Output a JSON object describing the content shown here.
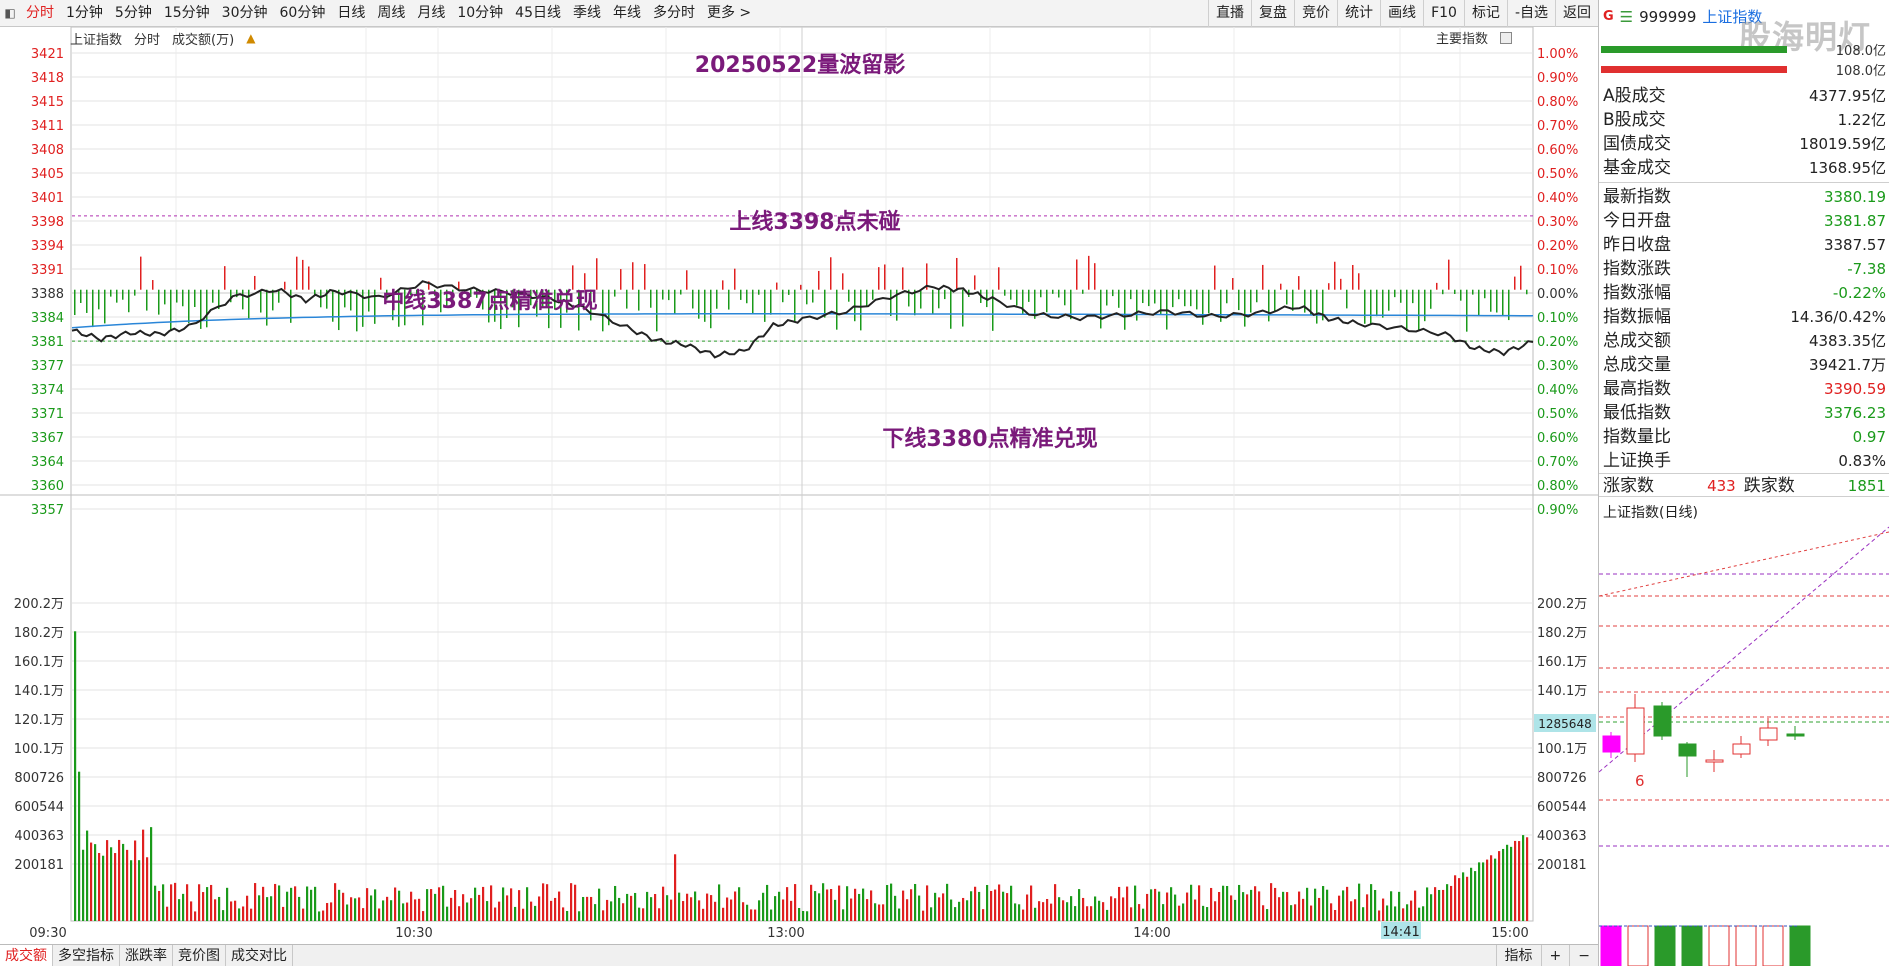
{
  "toolbar": {
    "periods": [
      {
        "label": "分时",
        "active": true
      },
      {
        "label": "1分钟"
      },
      {
        "label": "5分钟"
      },
      {
        "label": "15分钟"
      },
      {
        "label": "30分钟"
      },
      {
        "label": "60分钟"
      },
      {
        "label": "日线"
      },
      {
        "label": "周线"
      },
      {
        "label": "月线"
      },
      {
        "label": "10分钟"
      },
      {
        "label": "45日线"
      },
      {
        "label": "季线"
      },
      {
        "label": "年线"
      },
      {
        "label": "多分时"
      },
      {
        "label": "更多 >"
      }
    ],
    "right": [
      "直播",
      "复盘",
      "竞价",
      "统计",
      "画线",
      "F10",
      "标记",
      "-自选",
      "返回"
    ]
  },
  "chart": {
    "header_items": [
      "上证指数",
      "分时",
      "成交额(万)"
    ],
    "header_right": "主要指数",
    "title_annotation": "20250522量波留影",
    "annotations": {
      "upper": "上线3398点未碰",
      "middle": "中线3387点精准兑现",
      "lower": "下线3380点精准兑现"
    },
    "price_ticks": [
      "3421",
      "3418",
      "3415",
      "3411",
      "3408",
      "3405",
      "3401",
      "3398",
      "3394",
      "3391",
      "3388",
      "3384",
      "3381",
      "3377",
      "3374",
      "3371",
      "3367",
      "3364",
      "3360",
      "3357"
    ],
    "pct_ticks": [
      "1.00%",
      "0.90%",
      "0.80%",
      "0.70%",
      "0.60%",
      "0.50%",
      "0.40%",
      "0.30%",
      "0.20%",
      "0.10%",
      "0.00%",
      "0.10%",
      "0.20%",
      "0.30%",
      "0.40%",
      "0.50%",
      "0.60%",
      "0.70%",
      "0.80%",
      "0.90%"
    ],
    "vol_ticks": [
      "200.2万",
      "180.2万",
      "160.1万",
      "140.1万",
      "120.1万",
      "100.1万",
      "800726",
      "600544",
      "400363",
      "200181"
    ],
    "time_ticks": [
      "09:30",
      "10:30",
      "13:00",
      "14:00",
      "15:00"
    ],
    "cursor_time": "14:41",
    "cursor_value": "1285648",
    "prev_close": 3387.57,
    "colors": {
      "up": "#e02020",
      "down": "#1a9a1a",
      "price_line": "#222222",
      "avg_line": "#2a86d8",
      "annot": "#7a1a7a",
      "ref_purple": "#b030b0"
    }
  },
  "chart_data": {
    "type": "line",
    "title": "20250522量波留影",
    "ylabel": "上证指数",
    "ylim": [
      3355.5,
      3421
    ],
    "reference_lines": [
      {
        "label": "上线3398点未碰",
        "value": 3398
      },
      {
        "label": "下线3380点精准兑现",
        "value": 3380
      }
    ],
    "x": [
      "09:30",
      "10:30",
      "13:00",
      "14:00",
      "15:00"
    ],
    "series": [
      {
        "name": "上证指数",
        "values": [
          3381.87,
          3386.2,
          3387.4,
          3384.5,
          3380.19
        ]
      }
    ],
    "volume_ylim": [
      0,
      2002000
    ]
  },
  "side": {
    "g": "G",
    "eq": "☰",
    "code": "999999",
    "name": "上证指数",
    "watermark": "股海明灯",
    "amt1": "108.0亿",
    "amt2": "108.0亿",
    "group1": [
      {
        "label": "A股成交",
        "value": "4377.95亿"
      },
      {
        "label": "B股成交",
        "value": "1.22亿"
      },
      {
        "label": "国债成交",
        "value": "18019.59亿"
      },
      {
        "label": "基金成交",
        "value": "1368.95亿"
      }
    ],
    "group2": [
      {
        "label": "最新指数",
        "value": "3380.19",
        "color": "green"
      },
      {
        "label": "今日开盘",
        "value": "3381.87",
        "color": "green"
      },
      {
        "label": "昨日收盘",
        "value": "3387.57",
        "color": ""
      },
      {
        "label": "指数涨跌",
        "value": "-7.38",
        "color": "green"
      },
      {
        "label": "指数涨幅",
        "value": "-0.22%",
        "color": "green"
      },
      {
        "label": "指数振幅",
        "value": "14.36/0.42%",
        "color": ""
      },
      {
        "label": "总成交额",
        "value": "4383.35亿",
        "color": ""
      },
      {
        "label": "总成交量",
        "value": "39421.7万",
        "color": ""
      },
      {
        "label": "最高指数",
        "value": "3390.59",
        "color": "red"
      },
      {
        "label": "最低指数",
        "value": "3376.23",
        "color": "green"
      },
      {
        "label": "指数量比",
        "value": "0.97",
        "color": "green"
      },
      {
        "label": "上证换手",
        "value": "0.83%",
        "color": ""
      }
    ],
    "up_label": "涨家数",
    "up_count": "433",
    "down_label": "跌家数",
    "down_count": "1851",
    "kline_title": "上证指数(日线)",
    "kline_mark": "6"
  },
  "bottom_tabs": [
    "成交额",
    "多空指标",
    "涨跌率",
    "竞价图",
    "成交对比"
  ],
  "bottom_right": [
    "指标",
    "+",
    "−"
  ]
}
